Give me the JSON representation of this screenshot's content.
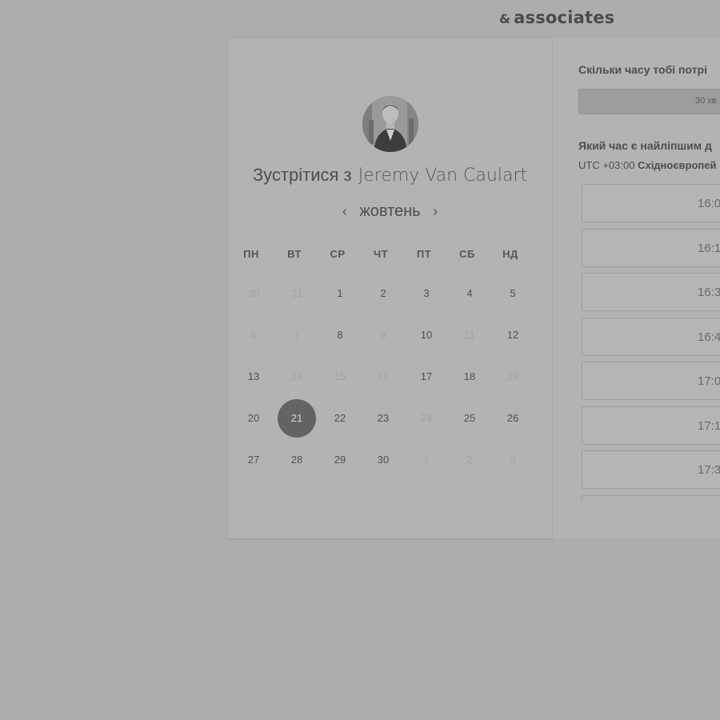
{
  "brand": {
    "amp": "&",
    "name": "associates"
  },
  "booking": {
    "title_prefix": "Зустрітися з",
    "host_name": "Jeremy Van Caulart",
    "prev_icon": "‹",
    "next_icon": "›",
    "month": "жовтень",
    "weekdays": [
      "ПН",
      "ВТ",
      "СР",
      "ЧТ",
      "ПТ",
      "СБ",
      "НД"
    ],
    "weeks": [
      [
        {
          "d": "30",
          "s": "dim"
        },
        {
          "d": "31",
          "s": "dim"
        },
        {
          "d": "1",
          "s": "avail"
        },
        {
          "d": "2",
          "s": "avail"
        },
        {
          "d": "3",
          "s": "avail"
        },
        {
          "d": "4",
          "s": "avail"
        },
        {
          "d": "5",
          "s": "avail"
        }
      ],
      [
        {
          "d": "6",
          "s": "dim"
        },
        {
          "d": "7",
          "s": "dim"
        },
        {
          "d": "8",
          "s": "avail"
        },
        {
          "d": "9",
          "s": "dim"
        },
        {
          "d": "10",
          "s": "avail"
        },
        {
          "d": "11",
          "s": "dim"
        },
        {
          "d": "12",
          "s": "avail"
        }
      ],
      [
        {
          "d": "13",
          "s": "avail"
        },
        {
          "d": "14",
          "s": "dim"
        },
        {
          "d": "15",
          "s": "dim"
        },
        {
          "d": "16",
          "s": "dim"
        },
        {
          "d": "17",
          "s": "avail"
        },
        {
          "d": "18",
          "s": "avail"
        },
        {
          "d": "19",
          "s": "dim"
        }
      ],
      [
        {
          "d": "20",
          "s": "avail"
        },
        {
          "d": "21",
          "s": "sel"
        },
        {
          "d": "22",
          "s": "avail"
        },
        {
          "d": "23",
          "s": "avail"
        },
        {
          "d": "24",
          "s": "dim"
        },
        {
          "d": "25",
          "s": "avail"
        },
        {
          "d": "26",
          "s": "avail"
        }
      ],
      [
        {
          "d": "27",
          "s": "avail"
        },
        {
          "d": "28",
          "s": "avail"
        },
        {
          "d": "29",
          "s": "avail"
        },
        {
          "d": "30",
          "s": "avail"
        },
        {
          "d": "1",
          "s": "dim"
        },
        {
          "d": "2",
          "s": "dim"
        },
        {
          "d": "3",
          "s": "dim"
        }
      ]
    ]
  },
  "scheduler": {
    "duration_question": "Скільки часу тобі потрі",
    "duration_value": "30 хв",
    "time_question": "Який час є найліпшим д",
    "timezone_prefix": "UTC +03:00",
    "timezone_name": "Східноєвропей",
    "slots": [
      "16:0",
      "16:1",
      "16:3",
      "16:4",
      "17:0",
      "17:1",
      "17:3",
      ""
    ]
  },
  "colors": {
    "background": "#adadad",
    "card": "#b3b3b3",
    "selected_day": "#636363"
  }
}
